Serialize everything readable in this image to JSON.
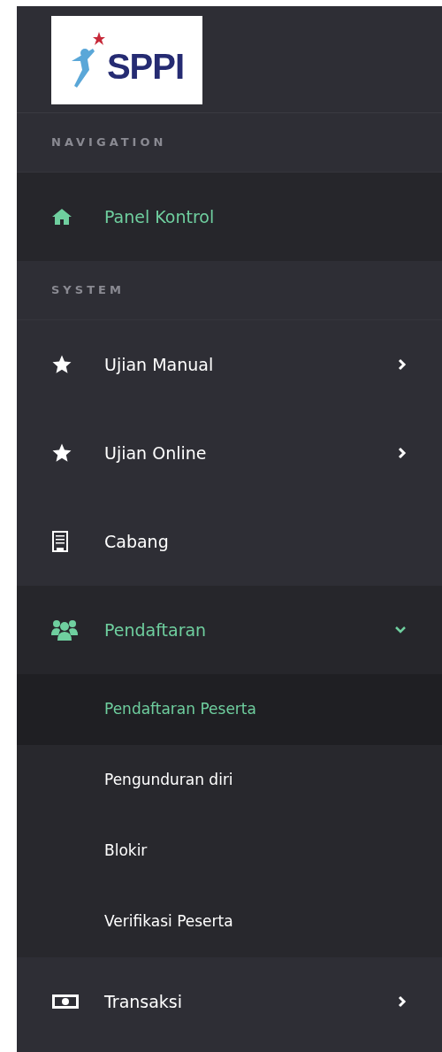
{
  "logo": {
    "text": "SPPI"
  },
  "sections": [
    {
      "title": "NAVIGATION",
      "items": [
        {
          "kind": "link",
          "label": "Panel Kontrol",
          "selected": true
        }
      ]
    },
    {
      "title": "SYSTEM",
      "items": [
        {
          "kind": "group",
          "label": "Ujian Manual",
          "selected": false,
          "expanded": false
        },
        {
          "kind": "group",
          "label": "Ujian Online",
          "selected": false,
          "expanded": false
        },
        {
          "kind": "link",
          "label": "Cabang",
          "selected": false
        },
        {
          "kind": "group",
          "label": "Pendaftaran",
          "selected": true,
          "expanded": true,
          "children": [
            {
              "label": "Pendaftaran Peserta",
              "selected": true
            },
            {
              "label": "Pengunduran diri",
              "selected": false
            },
            {
              "label": "Blokir",
              "selected": false
            },
            {
              "label": "Verifikasi Peserta",
              "selected": false
            }
          ]
        },
        {
          "kind": "group",
          "label": "Transaksi",
          "selected": false,
          "expanded": false
        }
      ]
    }
  ]
}
